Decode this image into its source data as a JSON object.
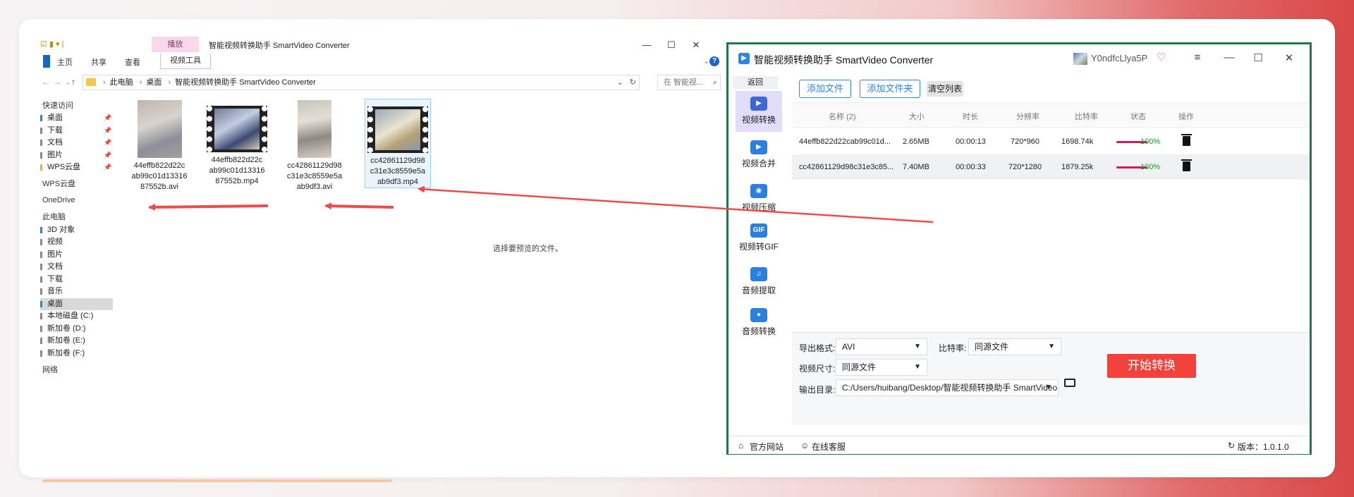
{
  "explorer": {
    "play_tab": "播放",
    "window_title": "智能视频转换助手 SmartVideo Converter",
    "ribbon_tabs": [
      "主页",
      "共享",
      "查看",
      "视频工具"
    ],
    "path": [
      "此电脑",
      "桌面",
      "智能视频转换助手 SmartVideo Converter"
    ],
    "search_placeholder": "在 智能视...",
    "sidebar": [
      {
        "label": "快速访问",
        "type": "head"
      },
      {
        "label": "桌面",
        "pin": true
      },
      {
        "label": "下载",
        "pin": true
      },
      {
        "label": "文档",
        "pin": true
      },
      {
        "label": "图片",
        "pin": true
      },
      {
        "label": "WPS云盘",
        "pin": true
      },
      {
        "label": "WPS云盘",
        "type": "head"
      },
      {
        "label": "OneDrive",
        "type": "head"
      },
      {
        "label": "此电脑",
        "type": "head"
      },
      {
        "label": "3D 对象"
      },
      {
        "label": "视频"
      },
      {
        "label": "图片"
      },
      {
        "label": "文档"
      },
      {
        "label": "下载"
      },
      {
        "label": "音乐"
      },
      {
        "label": "桌面",
        "selected": true
      },
      {
        "label": "本地磁盘 (C:)"
      },
      {
        "label": "新加卷 (D:)"
      },
      {
        "label": "新加卷 (E:)"
      },
      {
        "label": "新加卷 (F:)"
      },
      {
        "label": "网络",
        "type": "head"
      }
    ],
    "files": [
      {
        "name": "44effb822d22cab99c01d1331687552b.avi",
        "lines": [
          "44effb822d22c",
          "ab99c01d13316",
          "87552b.avi"
        ]
      },
      {
        "name": "44effb822d22cab99c01d1331687552b.mp4",
        "lines": [
          "44effb822d22c",
          "ab99c01d13316",
          "87552b.mp4"
        ]
      },
      {
        "name": "cc42861129d98c31e3c8559e5aab9df3.avi",
        "lines": [
          "cc42861129d98",
          "c31e3c8559e5a",
          "ab9df3.avi"
        ]
      },
      {
        "name": "cc42861129d98c31e3c8559e5aab9df3.mp4",
        "lines": [
          "cc42861129d98",
          "c31e3c8559e5a",
          "ab9df3.mp4"
        ]
      }
    ],
    "preview_text": "选择要预览的文件。"
  },
  "converter": {
    "title": "智能视频转换助手 SmartVideo Converter",
    "username": "Y0ndfcLlya5P",
    "back": "返回",
    "nav": [
      "视频转换",
      "视频合并",
      "视频压缩",
      "视频转GIF",
      "音频提取",
      "音频转换"
    ],
    "nav_icons": [
      "video-convert-icon",
      "video-merge-icon",
      "video-compress-icon",
      "gif-icon",
      "music-note-icon",
      "microphone-icon"
    ],
    "buttons": {
      "add_file": "添加文件",
      "add_folder": "添加文件夹",
      "clear_list": "清空列表"
    },
    "columns": [
      "名称 (2)",
      "大小",
      "时长",
      "分辨率",
      "比特率",
      "状态",
      "操作"
    ],
    "rows": [
      {
        "name": "44effb822d22cab99c01d...",
        "size": "2.65MB",
        "duration": "00:00:13",
        "resolution": "720*960",
        "bitrate": "1698.74k",
        "progress": "100%"
      },
      {
        "name": "cc42861129d98c31e3c85...",
        "size": "7.40MB",
        "duration": "00:00:33",
        "resolution": "720*1280",
        "bitrate": "1879.25k",
        "progress": "100%"
      }
    ],
    "export_format_label": "导出格式:",
    "export_format_value": "AVI",
    "bitrate_label": "比特率:",
    "bitrate_value": "同源文件",
    "size_label": "视频尺寸:",
    "size_value": "同源文件",
    "output_label": "输出目录:",
    "output_value": "C:/Users/huibang/Desktop/智能视频转换助手 SmartVideo",
    "start_button": "开始转换",
    "footer": {
      "website": "官方网站",
      "support": "在线客服",
      "version": "版本：1.0.1.0"
    }
  },
  "colors": {
    "accent_blue": "#2a86e8",
    "start_red": "#f3413b",
    "arrow_red": "#ef4b4b",
    "progress_pink": "#d6185b",
    "frame_green": "#1e7a49"
  }
}
